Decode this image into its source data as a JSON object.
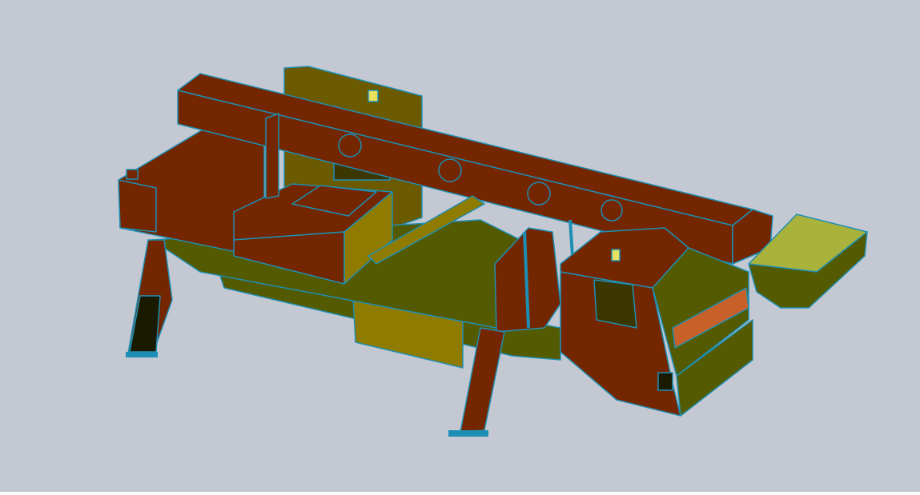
{
  "colors": {
    "background": "#c4c8d2",
    "edge": "#1e8fb4",
    "rust": "#732600",
    "rust_light": "#9a3300",
    "orange": "#c8602a",
    "olive": "#6b5a00",
    "olive_dark": "#545a00",
    "olive_yellow": "#8f7b00",
    "lime": "#a9b23a",
    "dark": "#1a1a00",
    "yellow": "#e8e060"
  }
}
